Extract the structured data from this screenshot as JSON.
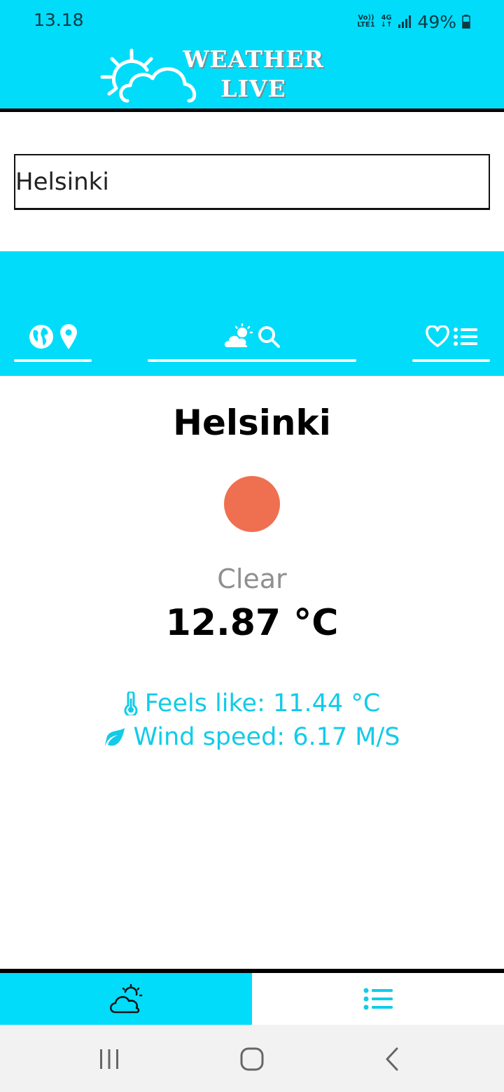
{
  "status_bar": {
    "time": "13.18",
    "network_top": "Vo))",
    "network_bottom": "LTE1",
    "network_type": "4G",
    "battery": "49%",
    "icons": [
      "volte-icon",
      "4g-icon",
      "signal-icon",
      "battery-icon"
    ]
  },
  "header": {
    "logo_line1": "WEATHER",
    "logo_line2": "LIVE",
    "logo_icon": "sun-cloud-icon"
  },
  "search": {
    "value": "Helsinki"
  },
  "tabs": [
    {
      "name": "location",
      "icons": [
        "globe-icon",
        "map-pin-icon"
      ],
      "selected": false
    },
    {
      "name": "search",
      "icons": [
        "cloud-sun-icon",
        "search-icon"
      ],
      "selected": true
    },
    {
      "name": "favorites",
      "icons": [
        "heart-icon",
        "list-icon"
      ],
      "selected": false
    }
  ],
  "weather": {
    "city": "Helsinki",
    "condition": "Clear",
    "temperature": "12.87 °C",
    "feels_like": "Feels like: 11.44 °C",
    "wind_speed": "Wind speed: 6.17 M/S",
    "condition_color": "#ee7050"
  },
  "bottom_nav": [
    {
      "name": "weather",
      "icon": "cloud-sun-icon",
      "active": true
    },
    {
      "name": "list",
      "icon": "list-icon",
      "active": false
    }
  ],
  "system_nav": [
    "recents-icon",
    "home-icon",
    "back-icon"
  ],
  "colors": {
    "accent": "#00dcfa",
    "detail_text": "#12cbe8",
    "divider": "#000000"
  }
}
